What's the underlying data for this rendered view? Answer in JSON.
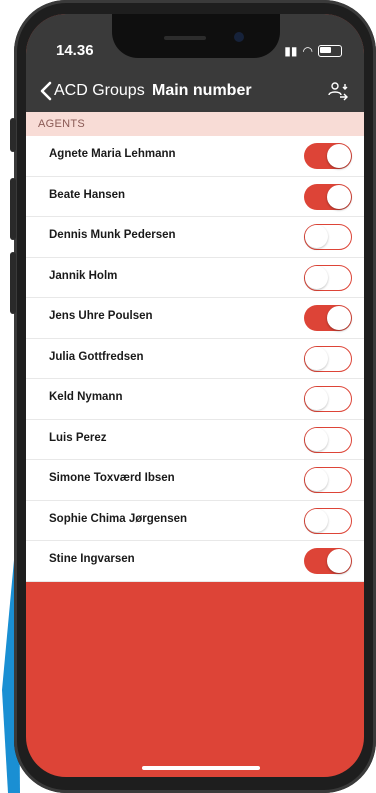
{
  "status_bar": {
    "time": "14.36"
  },
  "nav": {
    "back_label": "ACD Groups",
    "title": "Main number"
  },
  "section": {
    "header": "AGENTS"
  },
  "agents": [
    {
      "name": "Agnete Maria Lehmann",
      "enabled": true
    },
    {
      "name": "Beate Hansen",
      "enabled": true
    },
    {
      "name": "Dennis Munk Pedersen",
      "enabled": false
    },
    {
      "name": "Jannik Holm",
      "enabled": false
    },
    {
      "name": "Jens Uhre Poulsen",
      "enabled": true
    },
    {
      "name": "Julia Gottfredsen",
      "enabled": false
    },
    {
      "name": "Keld Nymann",
      "enabled": false
    },
    {
      "name": "Luis Perez",
      "enabled": false
    },
    {
      "name": "Simone Toxværd Ibsen",
      "enabled": false
    },
    {
      "name": "Sophie Chima Jørgensen",
      "enabled": false
    },
    {
      "name": "Stine Ingvarsen",
      "enabled": true
    }
  ],
  "colors": {
    "accent": "#dd4437",
    "header_bg": "#3a3a3a",
    "section_bg": "#f8dcd6"
  },
  "icons": {
    "back": "chevron-left-icon",
    "nav_action": "users-swap-icon"
  }
}
